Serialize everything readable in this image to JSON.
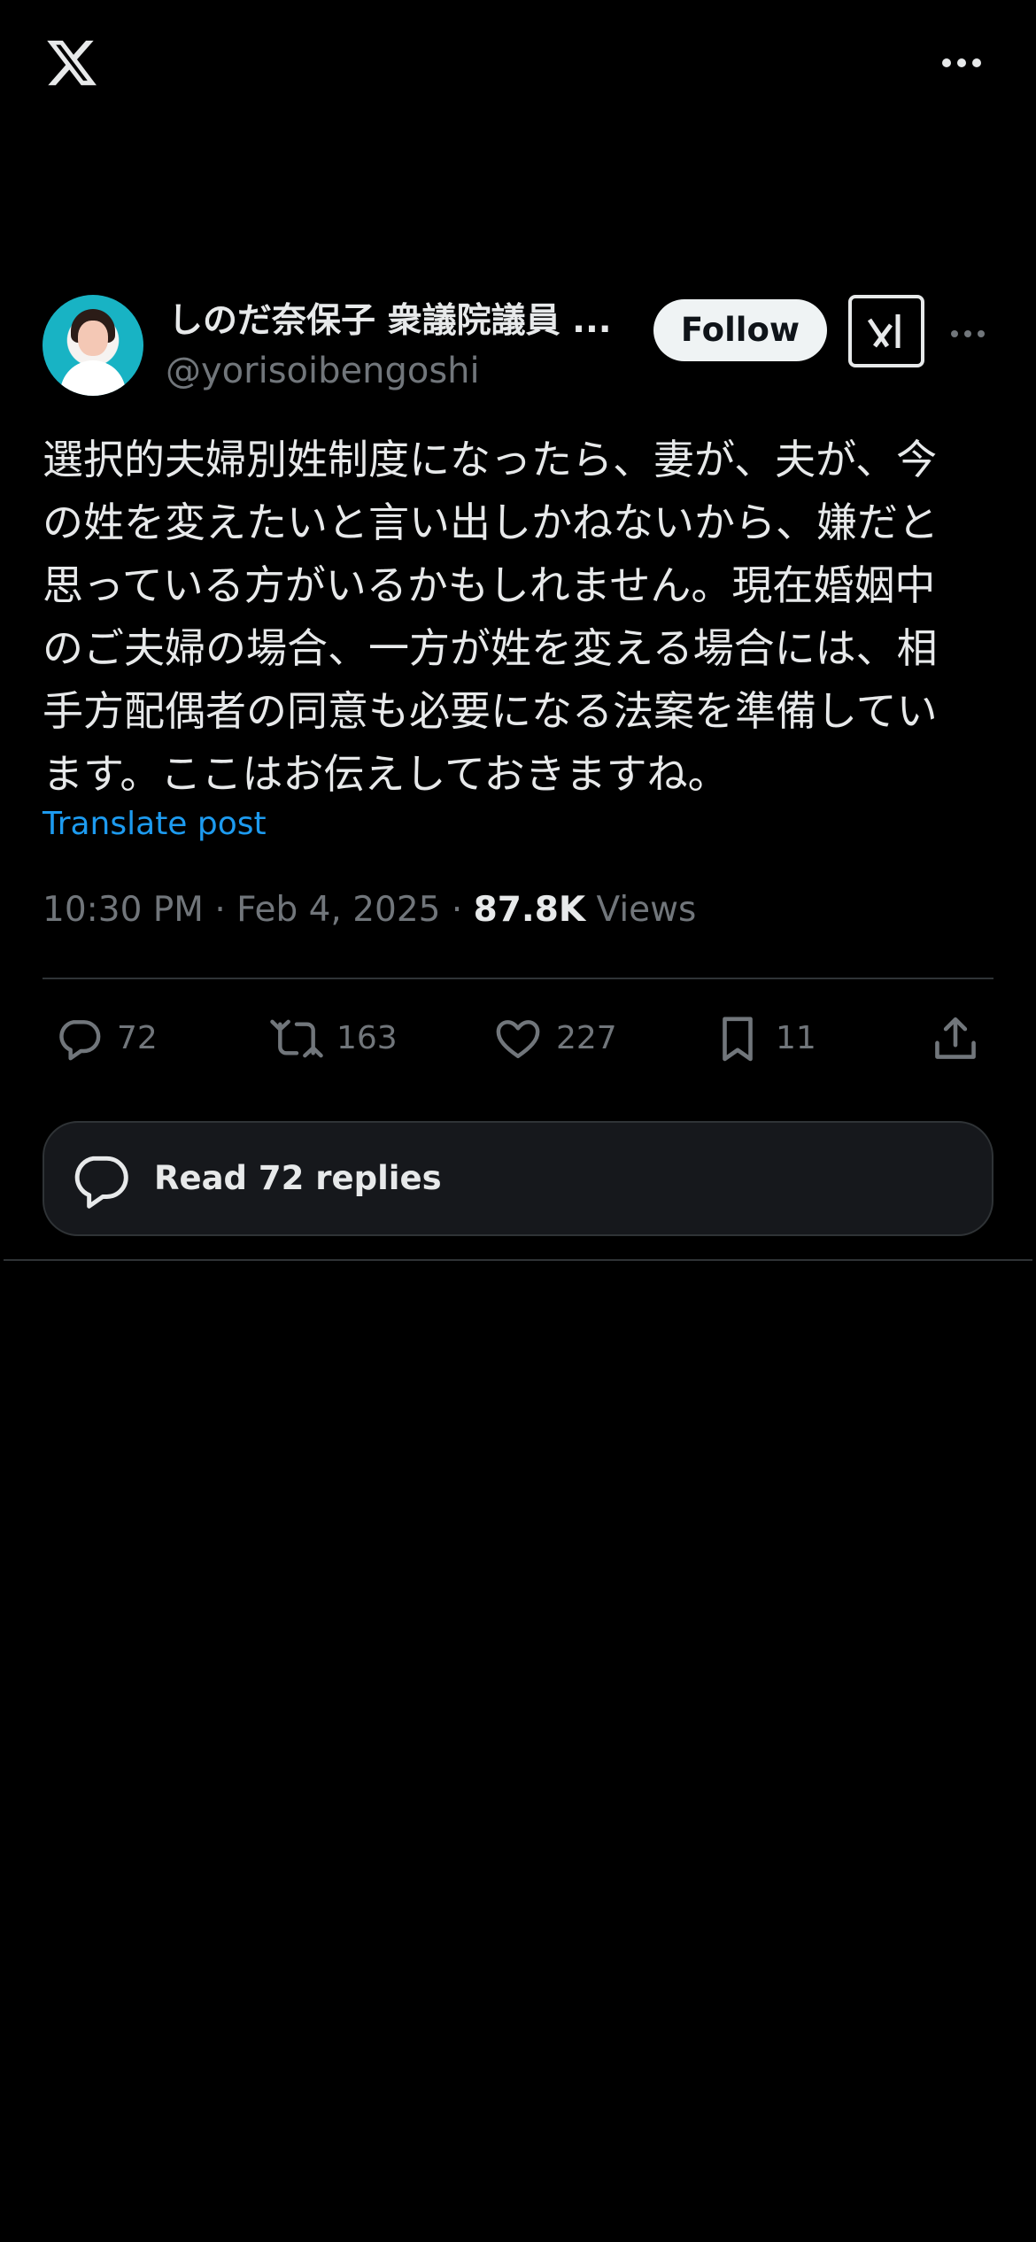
{
  "header": {
    "logo_icon": "x-logo-icon",
    "more_icon": "more-horizontal-icon"
  },
  "author": {
    "display_name": "しのだ奈保子 衆議院議員 ...",
    "handle": "@yorisoibengoshi",
    "follow_label": "Follow",
    "grok_icon": "grok-icon",
    "more_icon": "more-horizontal-icon"
  },
  "tweet": {
    "text_lines": [
      "選択的夫婦別姓制度になったら、妻が、夫が、今",
      "の姓を変えたいと言い出しかねないから、嫌だと",
      "思っている方がいるかもしれません。現在婚姻中",
      "のご夫婦の場合、一方が姓を変える場合には、相",
      "手方配偶者の同意も必要になる法案を準備してい",
      "ます。ここはお伝えしておきますね。"
    ],
    "translate_label": "Translate post",
    "timestamp": "10:30 PM · Feb 4, 2025 · ",
    "views_count": "87.8K",
    "views_label": " Views"
  },
  "actions": {
    "replies": "72",
    "retweets": "163",
    "likes": "227",
    "bookmarks": "11"
  },
  "read_replies_label": "Read 72 replies",
  "colors": {
    "background": "#000000",
    "text_primary": "#e7e9ea",
    "text_secondary": "#71767b",
    "link": "#1d9bf0",
    "divider": "#2f3336"
  }
}
